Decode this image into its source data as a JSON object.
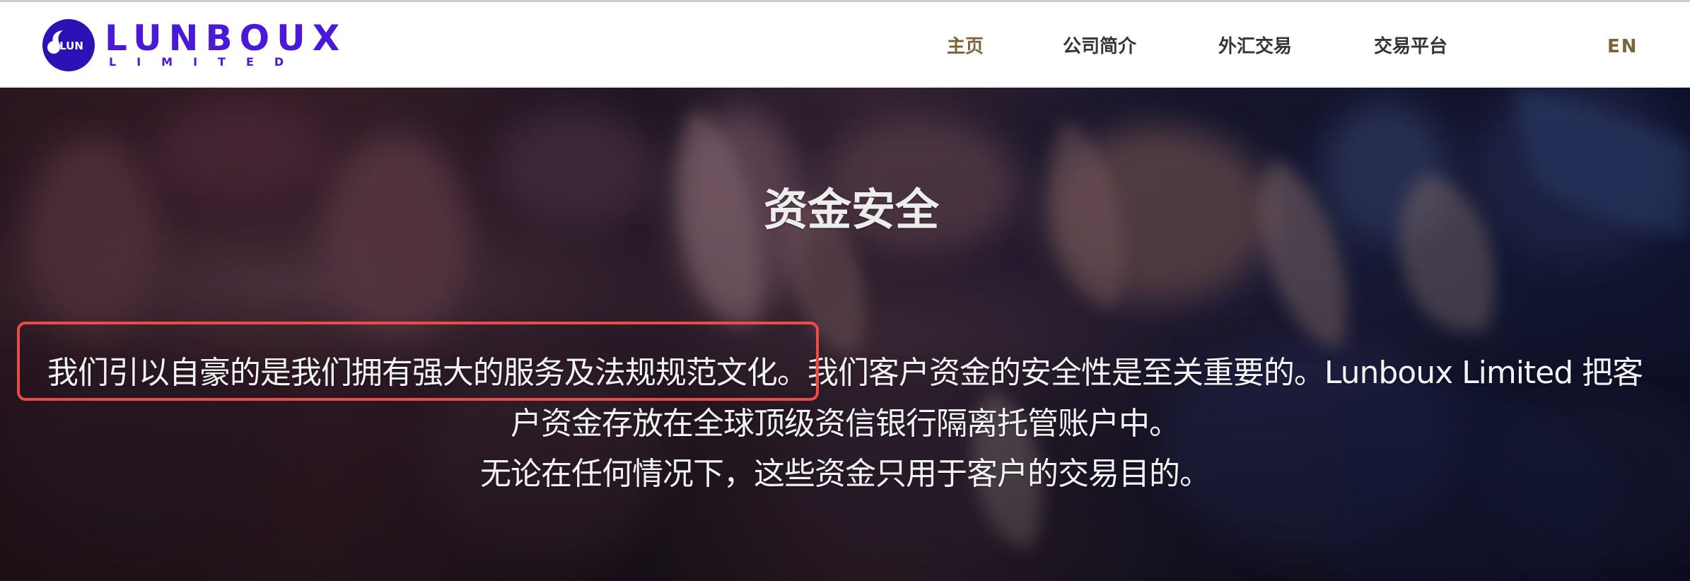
{
  "brand": {
    "name": "LUNBOUX",
    "subtitle": "LIMITED",
    "mark_text": "LUN",
    "color": "#4a18d7"
  },
  "navigation": {
    "items": [
      {
        "label": "主页",
        "active": true
      },
      {
        "label": "公司简介",
        "active": false
      },
      {
        "label": "外汇交易",
        "active": false
      },
      {
        "label": "交易平台",
        "active": false
      }
    ],
    "language": "EN"
  },
  "hero": {
    "title": "资金安全",
    "highlighted_text": "我们引以自豪的是我们拥有强大的服务及法规规范文化。",
    "line_one_remainder": "我们客户资金的安全性是至关重要的。Lunboux Limited 把客",
    "line_two": "户资金存放在全球顶级资信银行隔离托管账户中。",
    "line_three": "无论在任何情况下，这些资金只用于客户的交易目的。",
    "highlight_color": "#ec4b47"
  },
  "colors": {
    "active_nav": "#7a6338",
    "nav_text": "#353535",
    "hero_text": "#f2f2f2"
  }
}
